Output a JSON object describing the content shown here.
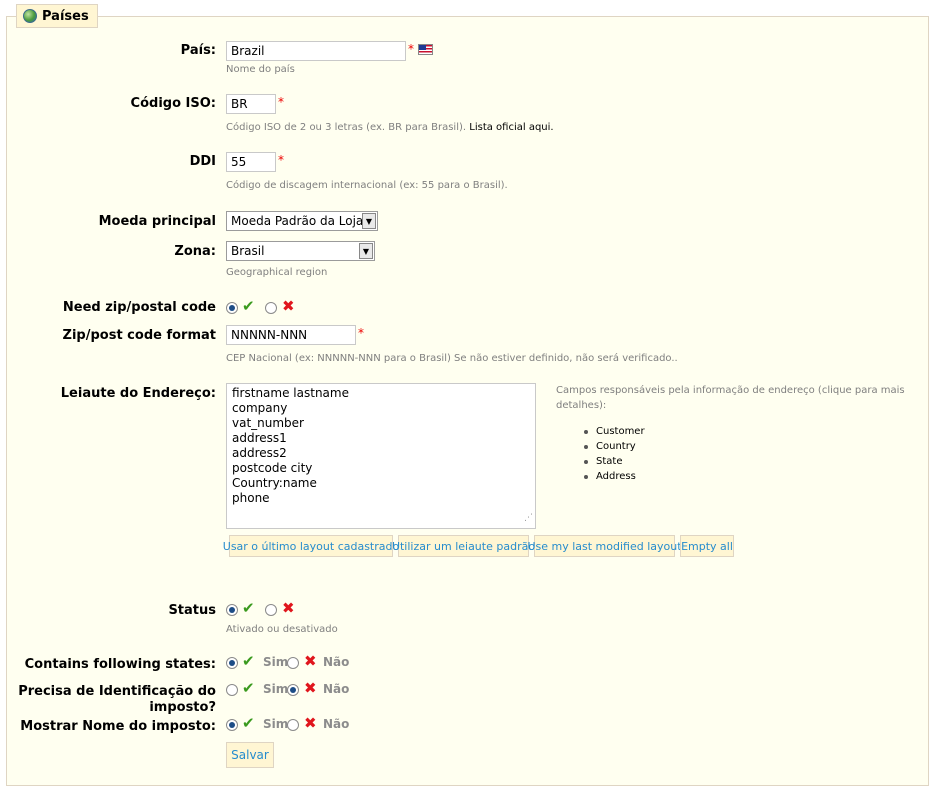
{
  "legend": {
    "title": "Países",
    "icon": "globe-icon"
  },
  "fields": {
    "pais": {
      "label": "País:",
      "value": "Brazil",
      "required": "*",
      "hint": "Nome do país"
    },
    "iso": {
      "label": "Código ISO:",
      "value": "BR",
      "required": "*",
      "hint": "Código ISO de 2 ou 3 letras (ex. BR para Brasil).",
      "hint_link": "Lista oficial aqui."
    },
    "ddi": {
      "label": "DDI",
      "value": "55",
      "required": "*",
      "hint": "Código de discagem internacional (ex: 55 para o Brasil)."
    },
    "moeda": {
      "label": "Moeda principal",
      "selected": "Moeda Padrão da Loja"
    },
    "zona": {
      "label": "Zona:",
      "selected": "Brasil",
      "hint": "Geographical region"
    },
    "need_zip": {
      "label": "Need zip/postal code",
      "selected": "yes"
    },
    "zip_format": {
      "label": "Zip/post code format",
      "value": "NNNNN-NNN",
      "required": "*",
      "hint": "CEP Nacional (ex: NNNNN-NNN para o Brasil) Se não estiver definido, não será verificado.."
    },
    "layout": {
      "label": "Leiaute do Endereço:",
      "lines": [
        "firstname lastname",
        "company",
        "vat_number",
        "address1",
        "address2",
        "postcode city",
        "Country:name",
        "phone"
      ],
      "side_text": "Campos responsáveis pela informação de endereço (clique para mais detalhes):",
      "side_items": [
        "Customer",
        "Country",
        "State",
        "Address"
      ],
      "buttons": [
        "Usar o último layout cadastrado",
        "Utilizar um leiaute padrão",
        "Use my last modified layout",
        "Empty all"
      ]
    },
    "status": {
      "label": "Status",
      "selected": "yes",
      "hint": "Ativado ou desativado"
    },
    "states": {
      "label": "Contains following states:",
      "selected": "yes",
      "yes": "Sim",
      "no": "Não"
    },
    "tax_id": {
      "label_line1": "Precisa de Identificação do",
      "label_line2": "imposto?",
      "selected": "no",
      "yes": "Sim",
      "no": "Não"
    },
    "tax_name": {
      "label": "Mostrar Nome do imposto:",
      "selected": "yes",
      "yes": "Sim",
      "no": "Não"
    }
  },
  "save_label": "Salvar",
  "colors": {
    "panel_bg": "#fffff0",
    "border": "#dfd5c3",
    "button_bg": "#fff6d3",
    "button_text": "#268ccd",
    "required": "#e00000",
    "check": "#3a9a1e",
    "cross": "#e0161d"
  }
}
